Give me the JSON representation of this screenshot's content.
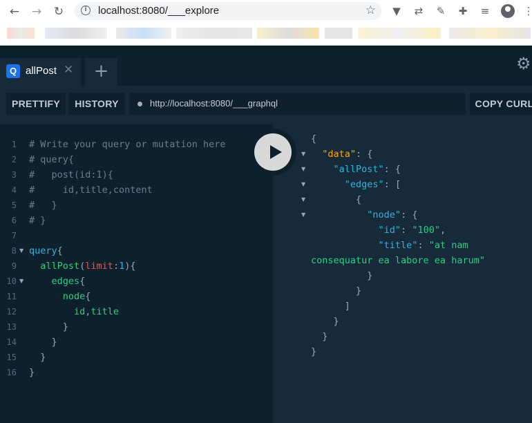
{
  "browser": {
    "url": "localhost:8080/___explore",
    "icons": [
      "back-icon",
      "forward-icon",
      "reload-icon",
      "info-icon",
      "star-icon",
      "extension-icons",
      "avatar",
      "menu-icon"
    ]
  },
  "graphiql": {
    "tab": {
      "badge": "Q",
      "label": "allPost",
      "close": "✕"
    },
    "add_tab": "+",
    "toolbar": {
      "prettify": "PRETTIFY",
      "history": "HISTORY",
      "endpoint": "http://localhost:8080/___graphql",
      "copy_curl": "COPY CURL"
    },
    "query_lines": [
      [
        {
          "t": "# Write your query or mutation here",
          "c": "comment"
        }
      ],
      [
        {
          "t": "# query{",
          "c": "comment"
        }
      ],
      [
        {
          "t": "#   post(id:1){",
          "c": "comment"
        }
      ],
      [
        {
          "t": "#     id,title,content",
          "c": "comment"
        }
      ],
      [
        {
          "t": "#   }",
          "c": "comment"
        }
      ],
      [
        {
          "t": "# }",
          "c": "comment"
        }
      ],
      [],
      [
        {
          "t": "query",
          "c": "kw"
        },
        {
          "t": "{",
          "c": "punct"
        }
      ],
      [
        {
          "t": "  allPost",
          "c": "field"
        },
        {
          "t": "(",
          "c": "punct"
        },
        {
          "t": "limit",
          "c": "arg"
        },
        {
          "t": ":",
          "c": "punct"
        },
        {
          "t": "1",
          "c": "num"
        },
        {
          "t": "){",
          "c": "punct"
        }
      ],
      [
        {
          "t": "    edges",
          "c": "field"
        },
        {
          "t": "{",
          "c": "punct"
        }
      ],
      [
        {
          "t": "      node",
          "c": "field"
        },
        {
          "t": "{",
          "c": "punct"
        }
      ],
      [
        {
          "t": "        id",
          "c": "field"
        },
        {
          "t": ",",
          "c": "punct"
        },
        {
          "t": "title",
          "c": "field"
        }
      ],
      [
        {
          "t": "      }",
          "c": "punct"
        }
      ],
      [
        {
          "t": "    }",
          "c": "punct"
        }
      ],
      [
        {
          "t": "  }",
          "c": "punct"
        }
      ],
      [
        {
          "t": "}",
          "c": "punct"
        }
      ]
    ],
    "query_folds": [
      8,
      10
    ],
    "result_lines": [
      [
        {
          "t": "{",
          "c": "punct"
        }
      ],
      [
        {
          "t": "  ",
          "c": "punct"
        },
        {
          "t": "\"data\"",
          "c": "key-orange"
        },
        {
          "t": ": {",
          "c": "punct"
        }
      ],
      [
        {
          "t": "    ",
          "c": "punct"
        },
        {
          "t": "\"allPost\"",
          "c": "key"
        },
        {
          "t": ": {",
          "c": "punct"
        }
      ],
      [
        {
          "t": "      ",
          "c": "punct"
        },
        {
          "t": "\"edges\"",
          "c": "key"
        },
        {
          "t": ": [",
          "c": "punct"
        }
      ],
      [
        {
          "t": "        {",
          "c": "punct"
        }
      ],
      [
        {
          "t": "          ",
          "c": "punct"
        },
        {
          "t": "\"node\"",
          "c": "key"
        },
        {
          "t": ": {",
          "c": "punct"
        }
      ],
      [
        {
          "t": "            ",
          "c": "punct"
        },
        {
          "t": "\"id\"",
          "c": "key"
        },
        {
          "t": ": ",
          "c": "punct"
        },
        {
          "t": "\"100\"",
          "c": "str"
        },
        {
          "t": ",",
          "c": "punct"
        }
      ],
      [
        {
          "t": "            ",
          "c": "punct"
        },
        {
          "t": "\"title\"",
          "c": "key"
        },
        {
          "t": ": ",
          "c": "punct"
        },
        {
          "t": "\"at nam",
          "c": "str"
        }
      ],
      [
        {
          "t": "consequatur ea labore ea harum\"",
          "c": "str"
        }
      ],
      [
        {
          "t": "          }",
          "c": "punct"
        }
      ],
      [
        {
          "t": "        }",
          "c": "punct"
        }
      ],
      [
        {
          "t": "      ]",
          "c": "punct"
        }
      ],
      [
        {
          "t": "    }",
          "c": "punct"
        }
      ],
      [
        {
          "t": "  }",
          "c": "punct"
        }
      ],
      [
        {
          "t": "}",
          "c": "punct"
        }
      ]
    ],
    "result_folds": [
      1,
      2,
      3,
      4,
      5
    ]
  }
}
